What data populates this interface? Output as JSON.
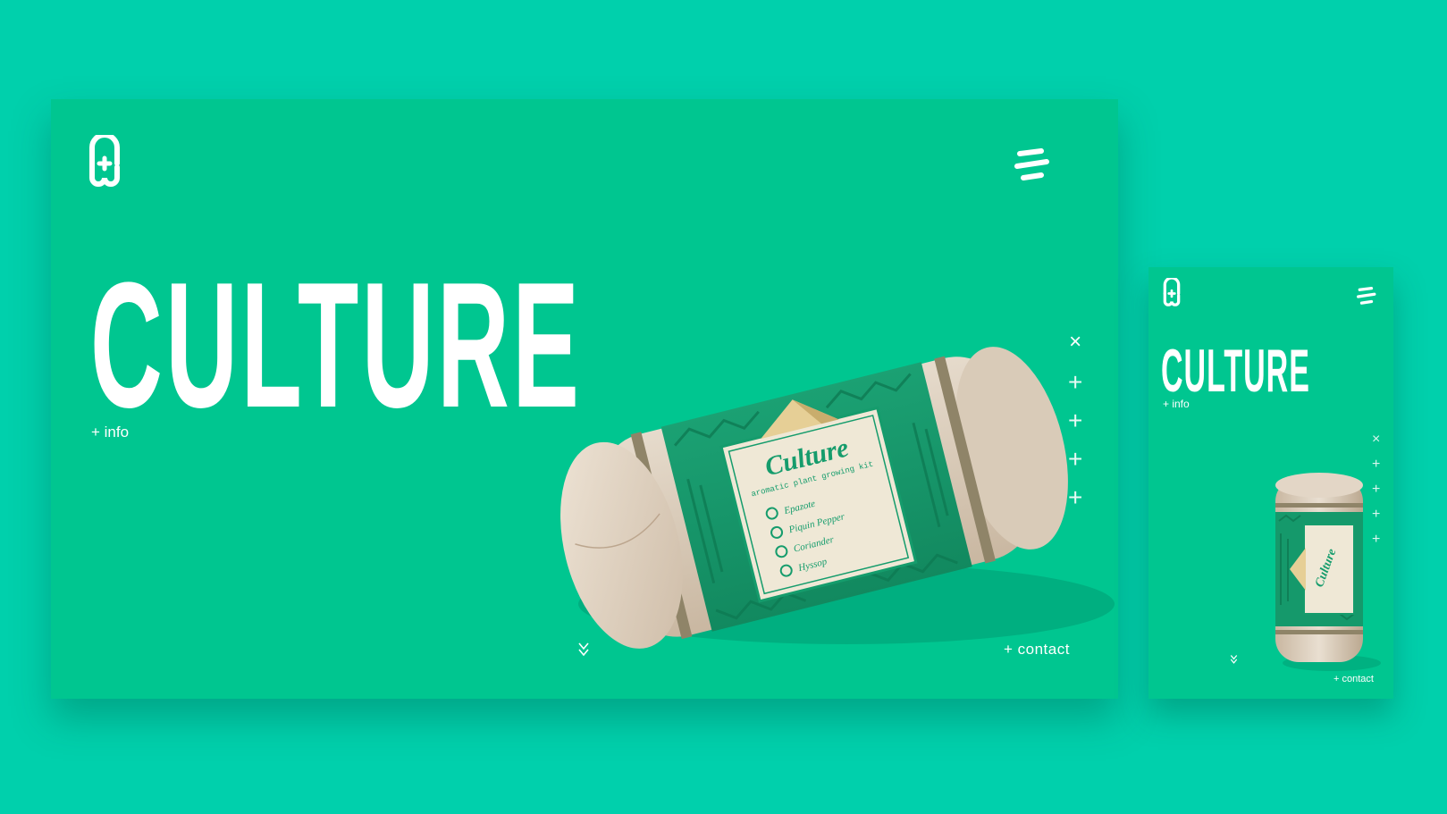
{
  "desktop": {
    "logo_icon": "cw-monogram-icon",
    "menu_icon": "hamburger-menu-icon",
    "title": "CULTURE",
    "info_label": "+ info",
    "contact_label": "+ contact",
    "side_nav": [
      "×",
      "+",
      "+",
      "+",
      "+"
    ],
    "scroll_icon": "double-chevron-down-icon"
  },
  "mobile": {
    "logo_icon": "cw-monogram-icon",
    "menu_icon": "hamburger-menu-icon",
    "title": "CULTURE",
    "info_label": "+ info",
    "contact_label": "+ contact",
    "side_nav": [
      "×",
      "+",
      "+",
      "+",
      "+"
    ],
    "scroll_icon": "double-chevron-down-icon"
  },
  "product": {
    "brand": "Culture",
    "subtitle": "aromatic plant growing kit",
    "items": [
      "Epazote",
      "Piquin Pepper",
      "Coriander",
      "Hyssop"
    ]
  },
  "colors": {
    "background": "#00d0ac",
    "screen": "#00c690",
    "label_green": "#159c6c",
    "canvas": "#e3d6c6",
    "text": "#ffffff"
  }
}
